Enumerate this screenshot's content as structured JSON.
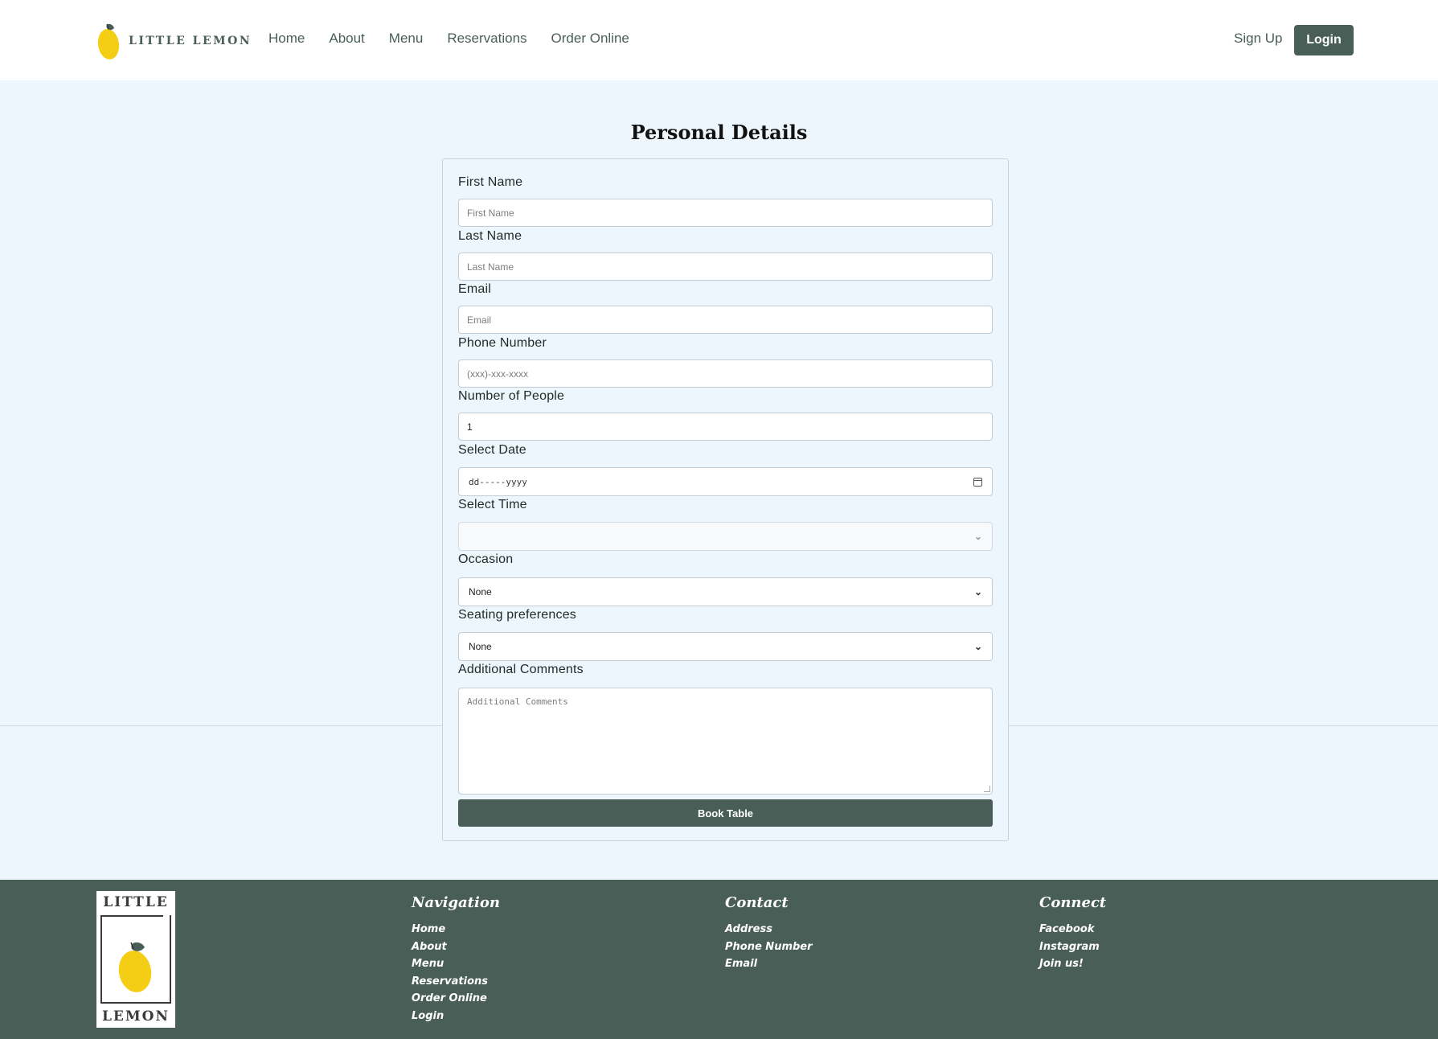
{
  "header": {
    "logo_text": "LITTLE LEMON",
    "nav": [
      "Home",
      "About",
      "Menu",
      "Reservations",
      "Order Online"
    ],
    "signup_label": "Sign Up",
    "login_label": "Login"
  },
  "page_title": "Personal Details",
  "form": {
    "first_name": {
      "label": "First Name",
      "placeholder": "First Name"
    },
    "last_name": {
      "label": "Last Name",
      "placeholder": "Last Name"
    },
    "email": {
      "label": "Email",
      "placeholder": "Email"
    },
    "phone": {
      "label": "Phone Number",
      "placeholder": "(xxx)-xxx-xxxx"
    },
    "people": {
      "label": "Number of People",
      "value": "1"
    },
    "date": {
      "label": "Select Date",
      "value": "dd-----yyyy"
    },
    "time": {
      "label": "Select Time",
      "value": ""
    },
    "occasion": {
      "label": "Occasion",
      "value": "None"
    },
    "seating": {
      "label": "Seating preferences",
      "value": "None"
    },
    "comments": {
      "label": "Additional Comments",
      "placeholder": "Additional Comments"
    },
    "submit_label": "Book Table"
  },
  "footer": {
    "logo_top": "LITTLE",
    "logo_bottom": "LEMON",
    "navigation": {
      "heading": "Navigation",
      "links": [
        "Home",
        "About",
        "Menu",
        "Reservations",
        "Order Online",
        "Login"
      ]
    },
    "contact": {
      "heading": "Contact",
      "links": [
        "Address",
        "Phone Number",
        "Email"
      ]
    },
    "connect": {
      "heading": "Connect",
      "links": [
        "Facebook",
        "Instagram",
        "Join us!"
      ]
    }
  },
  "colors": {
    "brand_green": "#495e57",
    "lemon_yellow": "#f4ce14",
    "page_bg": "#edf5fd"
  },
  "icons": [
    "lemon-logo-icon",
    "calendar-icon",
    "chevron-down-icon"
  ]
}
